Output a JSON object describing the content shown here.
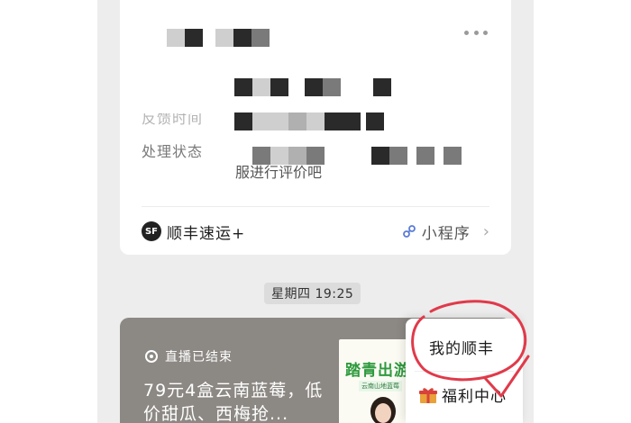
{
  "service_card": {
    "label_faded": "反馈时间",
    "label_status": "处理状态",
    "value_line": "服进行评价吧",
    "sender_name": "顺丰速运+",
    "sender_logo": "SF",
    "mini_program_label": "小程序",
    "chevron": "›"
  },
  "timestamp": "星期四 19:25",
  "live_card": {
    "status": "直播已结束",
    "title": "79元4盒云南蓝莓，低价甜瓜、西梅抢...",
    "thumb_title": "踏青出游",
    "thumb_tag": "云南山地蓝莓"
  },
  "popup_menu": {
    "items": [
      {
        "label": "我的顺丰"
      },
      {
        "label": "福利中心"
      }
    ]
  },
  "colors": {
    "chat_background": "#ededed",
    "annotation_red": "#e03a4a",
    "thumb_green": "#2e9a3e"
  },
  "icons": [
    "more-icon",
    "sf-logo-icon",
    "link-icon",
    "chevron-right-icon",
    "live-ended-icon",
    "gift-icon"
  ]
}
